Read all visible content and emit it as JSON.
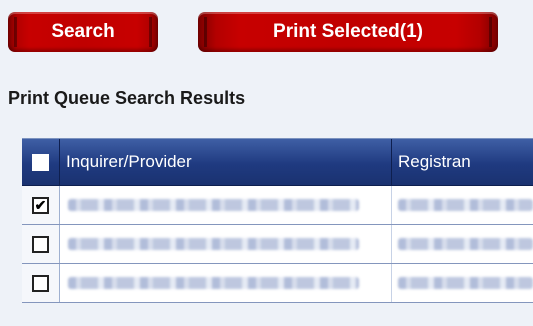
{
  "toolbar": {
    "search_label": "Search",
    "print_selected_label": "Print Selected(1)"
  },
  "results": {
    "title": "Print Queue Search Results"
  },
  "table": {
    "columns": [
      "Inquirer/Provider",
      "Registran"
    ],
    "rows": [
      {
        "checked": true
      },
      {
        "checked": false
      },
      {
        "checked": false
      }
    ]
  },
  "colors": {
    "button_red": "#c00000",
    "header_blue": "#1f3a80",
    "page_background": "#eef2f8"
  }
}
